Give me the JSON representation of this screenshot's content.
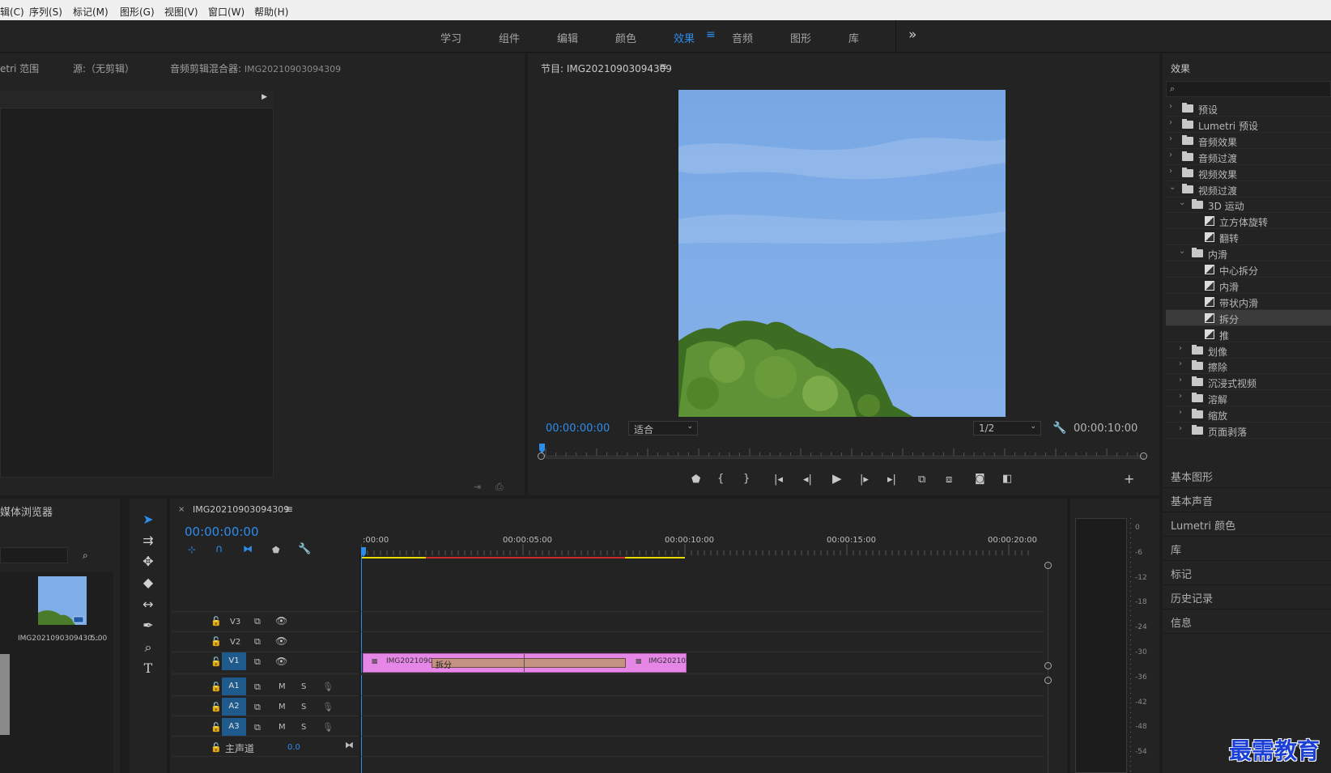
{
  "menu": [
    "辑(C)",
    "序列(S)",
    "标记(M)",
    "图形(G)",
    "视图(V)",
    "窗口(W)",
    "帮助(H)"
  ],
  "workspaces": [
    {
      "label": "学习",
      "active": false
    },
    {
      "label": "组件",
      "active": false
    },
    {
      "label": "编辑",
      "active": false
    },
    {
      "label": "颜色",
      "active": false
    },
    {
      "label": "效果",
      "active": true
    },
    {
      "label": "音频",
      "active": false
    },
    {
      "label": "图形",
      "active": false
    },
    {
      "label": "库",
      "active": false
    }
  ],
  "source_panel": {
    "tabs": [
      "etri 范围",
      "源:（无剪辑）",
      "音频剪辑混合器:"
    ],
    "mixer_clip": "IMG20210903094309"
  },
  "program": {
    "title": "节目: IMG20210903094309",
    "timecode_current": "00:00:00:00",
    "fit": "适合",
    "quality": "1/2",
    "timecode_duration": "00:00:10:00"
  },
  "effects": {
    "title": "效果",
    "tree": [
      {
        "label": "预设",
        "level": 0,
        "type": "folder",
        "exp": false
      },
      {
        "label": "Lumetri 预设",
        "level": 0,
        "type": "folder",
        "exp": false
      },
      {
        "label": "音频效果",
        "level": 0,
        "type": "folder",
        "exp": false
      },
      {
        "label": "音频过渡",
        "level": 0,
        "type": "folder",
        "exp": false
      },
      {
        "label": "视频效果",
        "level": 0,
        "type": "folder",
        "exp": false
      },
      {
        "label": "视频过渡",
        "level": 0,
        "type": "folder",
        "exp": true
      },
      {
        "label": "3D 运动",
        "level": 1,
        "type": "folder",
        "exp": true
      },
      {
        "label": "立方体旋转",
        "level": 2,
        "type": "item"
      },
      {
        "label": "翻转",
        "level": 2,
        "type": "item"
      },
      {
        "label": "内滑",
        "level": 1,
        "type": "folder",
        "exp": true
      },
      {
        "label": "中心拆分",
        "level": 2,
        "type": "item"
      },
      {
        "label": "内滑",
        "level": 2,
        "type": "item"
      },
      {
        "label": "带状内滑",
        "level": 2,
        "type": "item"
      },
      {
        "label": "拆分",
        "level": 2,
        "type": "item",
        "selected": true
      },
      {
        "label": "推",
        "level": 2,
        "type": "item"
      },
      {
        "label": "划像",
        "level": 1,
        "type": "folder",
        "exp": false
      },
      {
        "label": "擦除",
        "level": 1,
        "type": "folder",
        "exp": false
      },
      {
        "label": "沉浸式视频",
        "level": 1,
        "type": "folder",
        "exp": false
      },
      {
        "label": "溶解",
        "level": 1,
        "type": "folder",
        "exp": false
      },
      {
        "label": "缩放",
        "level": 1,
        "type": "folder",
        "exp": false
      },
      {
        "label": "页面剥落",
        "level": 1,
        "type": "folder",
        "exp": false
      }
    ]
  },
  "side_panels": [
    "基本图形",
    "基本声音",
    "Lumetri 颜色",
    "库",
    "标记",
    "历史记录",
    "信息"
  ],
  "media_browser": {
    "title": "媒体浏览器",
    "thumb_name": "IMG2021090309430...",
    "thumb_duration": "5:00"
  },
  "timeline": {
    "sequence_name": "IMG20210903094309",
    "timecode": "00:00:00:00",
    "ruler": [
      ":00:00",
      "00:00:05:00",
      "00:00:10:00",
      "00:00:15:00",
      "00:00:20:00"
    ],
    "video_tracks": [
      "V3",
      "V2",
      "V1"
    ],
    "audio_tracks": [
      "A1",
      "A2",
      "A3"
    ],
    "clip1": "IMG2021090",
    "transition": "拆分",
    "clip2": "IMG20210",
    "master_label": "主声道",
    "master_value": "0.0"
  },
  "meter_labels": [
    "0",
    "-6",
    "-12",
    "-18",
    "-24",
    "-30",
    "-36",
    "-42",
    "-48",
    "-54"
  ],
  "watermark": "最需教育",
  "colors": {
    "accent": "#2d8ceb",
    "clip": "#e686e6",
    "transition": "#c39280"
  }
}
